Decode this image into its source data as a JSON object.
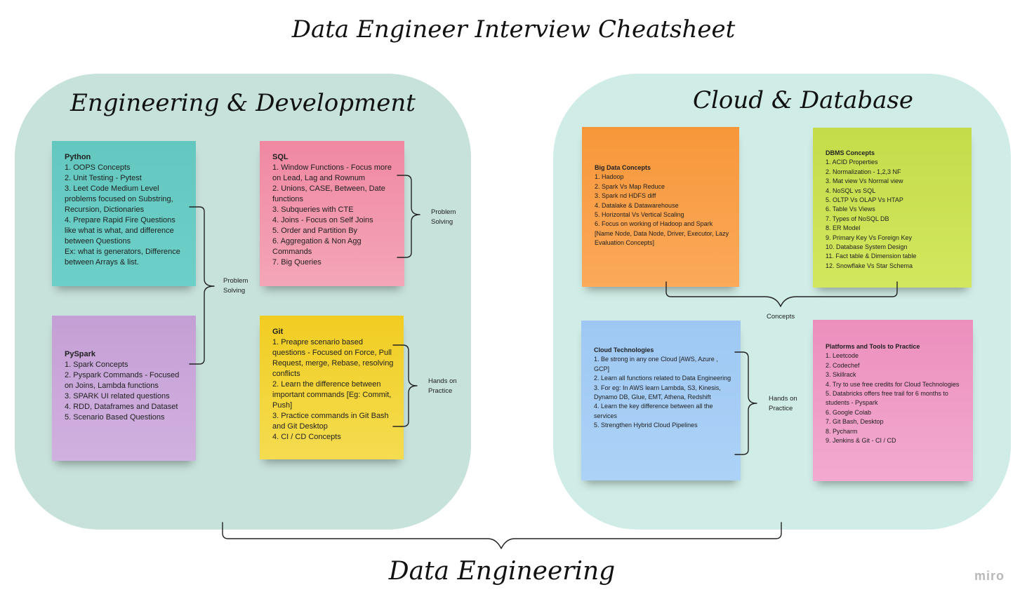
{
  "main_title": "Data Engineer Interview Cheatsheet",
  "bottom_title": "Data Engineering",
  "watermark": "miro",
  "left_zone": {
    "title": "Engineering & Development",
    "notes": {
      "python": {
        "title": "Python",
        "items": [
          "1. OOPS Concepts",
          "2. Unit Testing - Pytest",
          "3. Leet Code Medium Level problems focused on Substring, Recursion, Dictionaries",
          "4. Prepare Rapid Fire Questions like what is what, and difference between Questions",
          "Ex: what is generators, Difference between Arrays & list."
        ]
      },
      "pyspark": {
        "title": "PySpark",
        "items": [
          "1. Spark Concepts",
          "2. Pyspark Commands - Focused on Joins, Lambda functions",
          "3. SPARK UI related questions",
          "4. RDD, Dataframes and Dataset",
          "5. Scenario Based Questions"
        ]
      },
      "sql": {
        "title": "SQL",
        "items": [
          "1. Window Functions - Focus more on Lead, Lag and Rownum",
          "2. Unions, CASE, Between, Date functions",
          "3. Subqueries with CTE",
          "4. Joins - Focus on Self Joins",
          "5. Order and Partition By",
          "6. Aggregation & Non Agg Commands",
          "7. Big Queries"
        ]
      },
      "git": {
        "title": "Git",
        "items": [
          "1. Preapre scenario based questions - Focused on Force, Pull Request, merge, Rebase, resolving conflicts",
          "2. Learn the difference between important commands [Eg: Commit, Push]",
          "3. Practice commands in Git Bash and Git Desktop",
          "4. CI / CD Concepts"
        ]
      }
    },
    "labels": {
      "python_pyspark": "Problem Solving",
      "sql": "Problem Solving",
      "git": "Hands on Practice"
    }
  },
  "right_zone": {
    "title": "Cloud & Database",
    "notes": {
      "bigdata": {
        "title": "Big Data Concepts",
        "items": [
          "1. Hadoop",
          "2. Spark Vs Map Reduce",
          "3. Spark nd HDFS diff",
          "4. Datalake &  Datawarehouse",
          "5. Horizontal Vs Vertical Scaling",
          "6. Focus on working of Hadoop and Spark [Name Node, Data Node, Driver, Executor, Lazy Evaluation Concepts]"
        ]
      },
      "dbms": {
        "title": "DBMS Concepts",
        "items": [
          "1. ACID Properties",
          "2. Normalization - 1,2,3 NF",
          "3. Mat view Vs Normal view",
          "4. NoSQL vs SQL",
          "5. OLTP Vs OLAP Vs HTAP",
          "6. Table Vs Views",
          "7. Types of NoSQL DB",
          "8. ER Model",
          "9. Primary Key Vs Foreign Key",
          "10. Database System Design",
          "11. Fact table & Dimension table",
          "12. Snowflake Vs Star Schema"
        ]
      },
      "cloudtech": {
        "title": "Cloud Technologies",
        "items": [
          "1. Be strong in any one Cloud [AWS, Azure , GCP]",
          "2. Learn all functions related to Data Engineering",
          "3. For eg: In AWS learn Lambda, S3, Kinesis, Dynamo DB, Glue, EMT, Athena, Redshift",
          "4. Learn the key difference between all the services",
          "5. Strengthen Hybrid Cloud Pipelines"
        ]
      },
      "platforms": {
        "title": "Platforms and Tools  to Practice",
        "items": [
          "1. Leetcode",
          "2. Codechef",
          "3. Skillrack",
          "4. Try to use free credits for Cloud Technologies",
          "5. Databricks offers free trail for 6 months to students - Pyspark",
          "6. Google Colab",
          "7. Git Bash, Desktop",
          "8.  Pycharm",
          "9. Jenkins & Git - CI / CD"
        ]
      }
    },
    "labels": {
      "concepts": "Concepts",
      "cloudtech": "Hands on Practice"
    }
  }
}
